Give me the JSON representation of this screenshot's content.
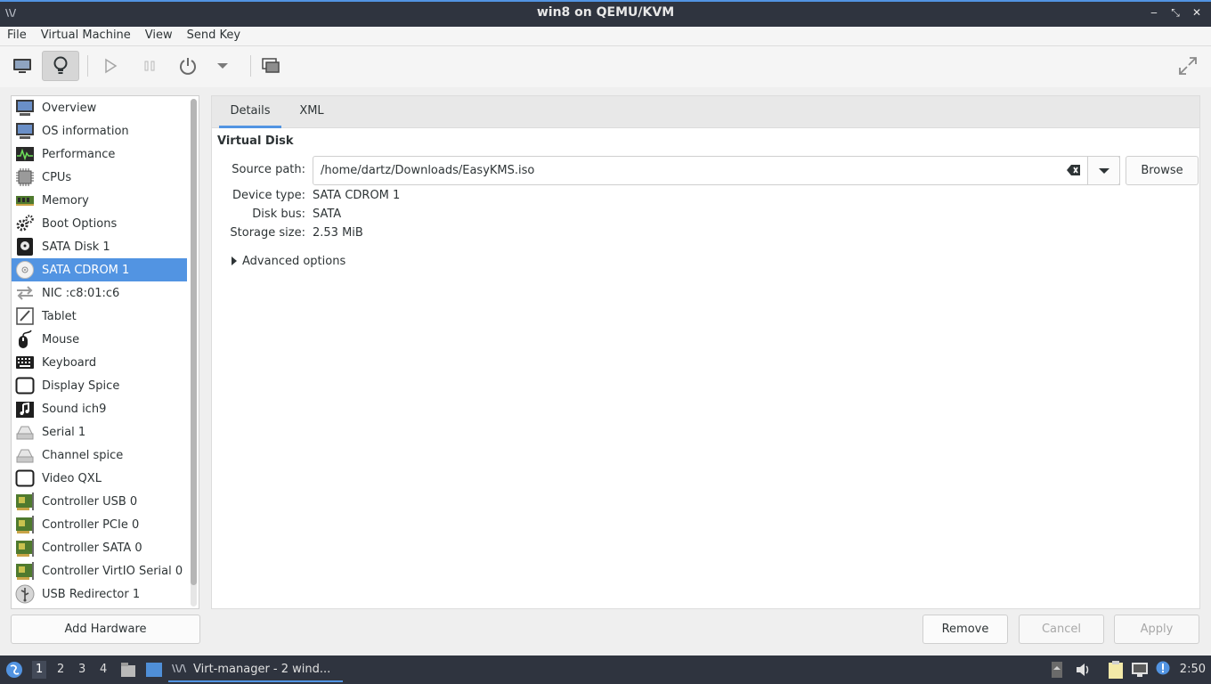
{
  "window": {
    "title": "win8 on QEMU/KVM"
  },
  "menu": [
    "File",
    "Virtual Machine",
    "View",
    "Send Key"
  ],
  "toolbar": {
    "buttons": [
      "console-icon",
      "details-icon",
      "run-icon",
      "pause-icon",
      "power-icon",
      "power-menu-icon",
      "snapshots-icon",
      "fullscreen-icon"
    ]
  },
  "hardware": [
    {
      "label": "Overview",
      "icon": "monitor-icon"
    },
    {
      "label": "OS information",
      "icon": "monitor-icon"
    },
    {
      "label": "Performance",
      "icon": "performance-icon"
    },
    {
      "label": "CPUs",
      "icon": "cpu-icon"
    },
    {
      "label": "Memory",
      "icon": "memory-icon"
    },
    {
      "label": "Boot Options",
      "icon": "gears-icon"
    },
    {
      "label": "SATA Disk 1",
      "icon": "disk-icon"
    },
    {
      "label": "SATA CDROM 1",
      "icon": "cdrom-icon",
      "selected": true
    },
    {
      "label": "NIC :c8:01:c6",
      "icon": "network-icon"
    },
    {
      "label": "Tablet",
      "icon": "tablet-icon"
    },
    {
      "label": "Mouse",
      "icon": "mouse-icon"
    },
    {
      "label": "Keyboard",
      "icon": "keyboard-icon"
    },
    {
      "label": "Display Spice",
      "icon": "display-icon"
    },
    {
      "label": "Sound ich9",
      "icon": "sound-icon"
    },
    {
      "label": "Serial 1",
      "icon": "serial-icon"
    },
    {
      "label": "Channel spice",
      "icon": "serial-icon"
    },
    {
      "label": "Video QXL",
      "icon": "display-icon"
    },
    {
      "label": "Controller USB 0",
      "icon": "controller-icon"
    },
    {
      "label": "Controller PCIe 0",
      "icon": "controller-icon"
    },
    {
      "label": "Controller SATA 0",
      "icon": "controller-icon"
    },
    {
      "label": "Controller VirtIO Serial 0",
      "icon": "controller-icon"
    },
    {
      "label": "USB Redirector 1",
      "icon": "usb-icon"
    }
  ],
  "add_hardware": "Add Hardware",
  "tabs": [
    "Details",
    "XML"
  ],
  "details": {
    "section_title": "Virtual Disk",
    "source_label": "Source path:",
    "source_value": "/home/dartz/Downloads/EasyKMS.iso",
    "browse": "Browse",
    "device_type_label": "Device type:",
    "device_type": "SATA CDROM 1",
    "disk_bus_label": "Disk bus:",
    "disk_bus": "SATA",
    "storage_size_label": "Storage size:",
    "storage_size": "2.53 MiB",
    "advanced": "Advanced options"
  },
  "actions": {
    "remove": "Remove",
    "cancel": "Cancel",
    "apply": "Apply"
  },
  "taskbar": {
    "workspaces": [
      "1",
      "2",
      "3",
      "4"
    ],
    "task": "Virt-manager - 2 wind...",
    "clock": "2:50"
  },
  "colors": {
    "accent": "#5294e2",
    "titlebar": "#2f343f"
  }
}
